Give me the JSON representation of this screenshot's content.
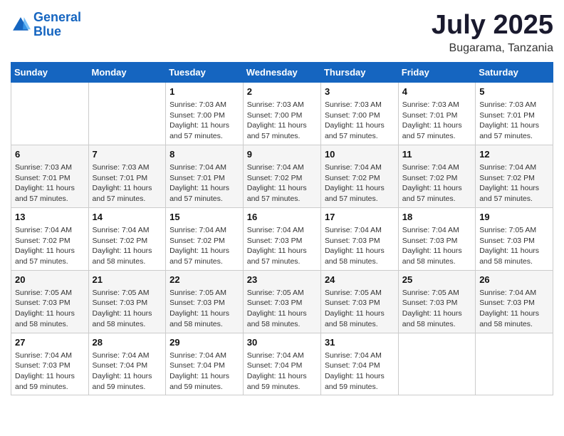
{
  "logo": {
    "line1": "General",
    "line2": "Blue"
  },
  "title": "July 2025",
  "location": "Bugarama, Tanzania",
  "weekdays": [
    "Sunday",
    "Monday",
    "Tuesday",
    "Wednesday",
    "Thursday",
    "Friday",
    "Saturday"
  ],
  "weeks": [
    [
      {
        "day": null,
        "info": null
      },
      {
        "day": null,
        "info": null
      },
      {
        "day": "1",
        "sunrise": "7:03 AM",
        "sunset": "7:00 PM",
        "daylight": "11 hours and 57 minutes."
      },
      {
        "day": "2",
        "sunrise": "7:03 AM",
        "sunset": "7:00 PM",
        "daylight": "11 hours and 57 minutes."
      },
      {
        "day": "3",
        "sunrise": "7:03 AM",
        "sunset": "7:00 PM",
        "daylight": "11 hours and 57 minutes."
      },
      {
        "day": "4",
        "sunrise": "7:03 AM",
        "sunset": "7:01 PM",
        "daylight": "11 hours and 57 minutes."
      },
      {
        "day": "5",
        "sunrise": "7:03 AM",
        "sunset": "7:01 PM",
        "daylight": "11 hours and 57 minutes."
      }
    ],
    [
      {
        "day": "6",
        "sunrise": "7:03 AM",
        "sunset": "7:01 PM",
        "daylight": "11 hours and 57 minutes."
      },
      {
        "day": "7",
        "sunrise": "7:03 AM",
        "sunset": "7:01 PM",
        "daylight": "11 hours and 57 minutes."
      },
      {
        "day": "8",
        "sunrise": "7:04 AM",
        "sunset": "7:01 PM",
        "daylight": "11 hours and 57 minutes."
      },
      {
        "day": "9",
        "sunrise": "7:04 AM",
        "sunset": "7:02 PM",
        "daylight": "11 hours and 57 minutes."
      },
      {
        "day": "10",
        "sunrise": "7:04 AM",
        "sunset": "7:02 PM",
        "daylight": "11 hours and 57 minutes."
      },
      {
        "day": "11",
        "sunrise": "7:04 AM",
        "sunset": "7:02 PM",
        "daylight": "11 hours and 57 minutes."
      },
      {
        "day": "12",
        "sunrise": "7:04 AM",
        "sunset": "7:02 PM",
        "daylight": "11 hours and 57 minutes."
      }
    ],
    [
      {
        "day": "13",
        "sunrise": "7:04 AM",
        "sunset": "7:02 PM",
        "daylight": "11 hours and 57 minutes."
      },
      {
        "day": "14",
        "sunrise": "7:04 AM",
        "sunset": "7:02 PM",
        "daylight": "11 hours and 58 minutes."
      },
      {
        "day": "15",
        "sunrise": "7:04 AM",
        "sunset": "7:02 PM",
        "daylight": "11 hours and 57 minutes."
      },
      {
        "day": "16",
        "sunrise": "7:04 AM",
        "sunset": "7:03 PM",
        "daylight": "11 hours and 57 minutes."
      },
      {
        "day": "17",
        "sunrise": "7:04 AM",
        "sunset": "7:03 PM",
        "daylight": "11 hours and 58 minutes."
      },
      {
        "day": "18",
        "sunrise": "7:04 AM",
        "sunset": "7:03 PM",
        "daylight": "11 hours and 58 minutes."
      },
      {
        "day": "19",
        "sunrise": "7:05 AM",
        "sunset": "7:03 PM",
        "daylight": "11 hours and 58 minutes."
      }
    ],
    [
      {
        "day": "20",
        "sunrise": "7:05 AM",
        "sunset": "7:03 PM",
        "daylight": "11 hours and 58 minutes."
      },
      {
        "day": "21",
        "sunrise": "7:05 AM",
        "sunset": "7:03 PM",
        "daylight": "11 hours and 58 minutes."
      },
      {
        "day": "22",
        "sunrise": "7:05 AM",
        "sunset": "7:03 PM",
        "daylight": "11 hours and 58 minutes."
      },
      {
        "day": "23",
        "sunrise": "7:05 AM",
        "sunset": "7:03 PM",
        "daylight": "11 hours and 58 minutes."
      },
      {
        "day": "24",
        "sunrise": "7:05 AM",
        "sunset": "7:03 PM",
        "daylight": "11 hours and 58 minutes."
      },
      {
        "day": "25",
        "sunrise": "7:05 AM",
        "sunset": "7:03 PM",
        "daylight": "11 hours and 58 minutes."
      },
      {
        "day": "26",
        "sunrise": "7:04 AM",
        "sunset": "7:03 PM",
        "daylight": "11 hours and 58 minutes."
      }
    ],
    [
      {
        "day": "27",
        "sunrise": "7:04 AM",
        "sunset": "7:03 PM",
        "daylight": "11 hours and 59 minutes."
      },
      {
        "day": "28",
        "sunrise": "7:04 AM",
        "sunset": "7:04 PM",
        "daylight": "11 hours and 59 minutes."
      },
      {
        "day": "29",
        "sunrise": "7:04 AM",
        "sunset": "7:04 PM",
        "daylight": "11 hours and 59 minutes."
      },
      {
        "day": "30",
        "sunrise": "7:04 AM",
        "sunset": "7:04 PM",
        "daylight": "11 hours and 59 minutes."
      },
      {
        "day": "31",
        "sunrise": "7:04 AM",
        "sunset": "7:04 PM",
        "daylight": "11 hours and 59 minutes."
      },
      {
        "day": null,
        "info": null
      },
      {
        "day": null,
        "info": null
      }
    ]
  ]
}
